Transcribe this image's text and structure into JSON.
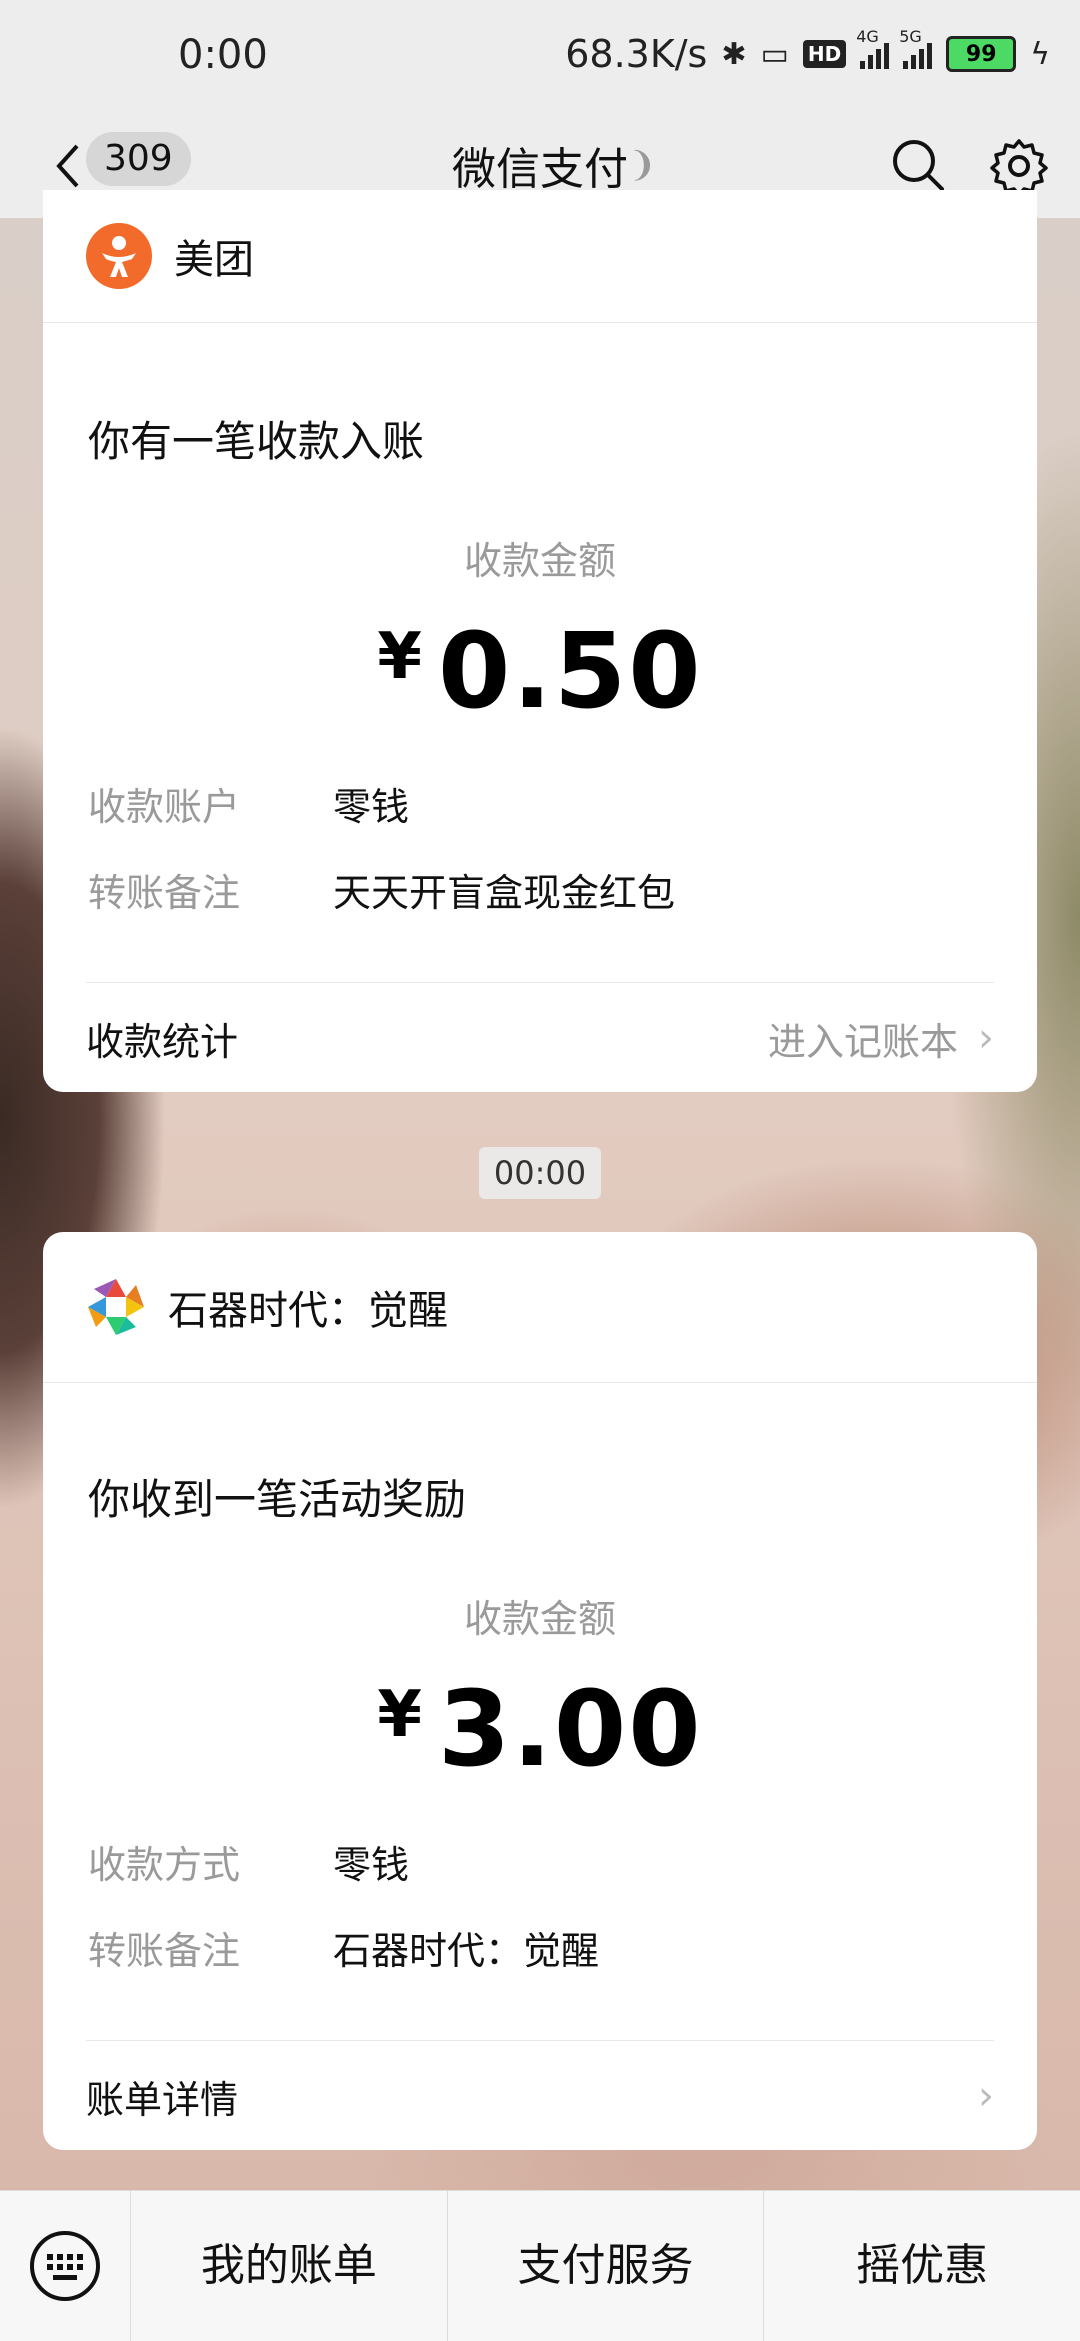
{
  "status_bar": {
    "time": "0:00",
    "speed": "68.3K/s",
    "hd_label": "HD",
    "net1_label": "4G",
    "net2_label": "5G",
    "battery": "99"
  },
  "nav": {
    "unread_count": "309",
    "title": "微信支付"
  },
  "cards": [
    {
      "merchant": "美团",
      "message": "你有一笔收款入账",
      "amount_label": "收款金额",
      "currency": "¥",
      "amount": "0.50",
      "rows": [
        {
          "key": "收款账户",
          "value": "零钱"
        },
        {
          "key": "转账备注",
          "value": "天天开盲盒现金红包"
        }
      ],
      "footer_left": "收款统计",
      "footer_right": "进入记账本"
    },
    {
      "merchant": "石器时代：觉醒",
      "message": "你收到一笔活动奖励",
      "amount_label": "收款金额",
      "currency": "¥",
      "amount": "3.00",
      "rows": [
        {
          "key": "收款方式",
          "value": "零钱"
        },
        {
          "key": "转账备注",
          "value": "石器时代：觉醒"
        }
      ],
      "footer_left": "账单详情",
      "footer_right": ""
    }
  ],
  "timestamp": "00:00",
  "bottom_tabs": [
    "我的账单",
    "支付服务",
    "摇优惠"
  ],
  "colors": {
    "meituan_orange": "#f26b2a",
    "background": "#ededed",
    "card": "#ffffff"
  }
}
